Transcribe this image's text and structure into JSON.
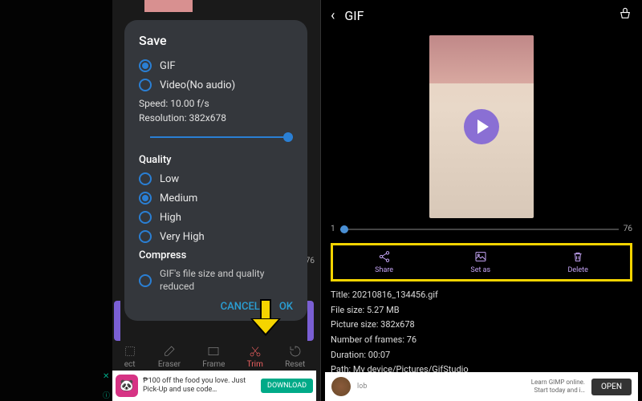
{
  "left": {
    "dialog": {
      "title": "Save",
      "format": {
        "gif": "GIF",
        "video": "Video(No audio)",
        "selected": "gif"
      },
      "speed_line": "Speed: 10.00 f/s",
      "resolution_line": "Resolution: 382x678",
      "quality": {
        "label": "Quality",
        "low": "Low",
        "medium": "Medium",
        "high": "High",
        "very_high": "Very High",
        "selected": "medium"
      },
      "compress": {
        "label": "Compress",
        "desc": "GIF's file size and quality reduced"
      },
      "cancel": "CANCEL",
      "ok": "OK"
    },
    "timeline_end": "76",
    "tools": {
      "select": "ect",
      "eraser": "Eraser",
      "frame": "Frame",
      "trim": "Trim",
      "reset": "Reset"
    },
    "ad": {
      "text": "₱100 off the food you love. Just Pick-Up and use code…",
      "cta": "DOWNLOAD"
    }
  },
  "right": {
    "header": {
      "title": "GIF"
    },
    "timeline": {
      "start": "1",
      "end": "76"
    },
    "actions": {
      "share": "Share",
      "setas": "Set as",
      "delete": "Delete"
    },
    "info": {
      "title": "Title: 20210816_134456.gif",
      "filesize": "File size: 5.27 MB",
      "picsize": "Picture size: 382x678",
      "frames": "Number of frames: 76",
      "duration": "Duration: 00:07",
      "path": "Path: My device/Pictures/GifStudio"
    },
    "ad": {
      "label": "lob",
      "line1": "Learn GIMP online.",
      "line2": "Start today and i…",
      "cta": "OPEN"
    }
  }
}
